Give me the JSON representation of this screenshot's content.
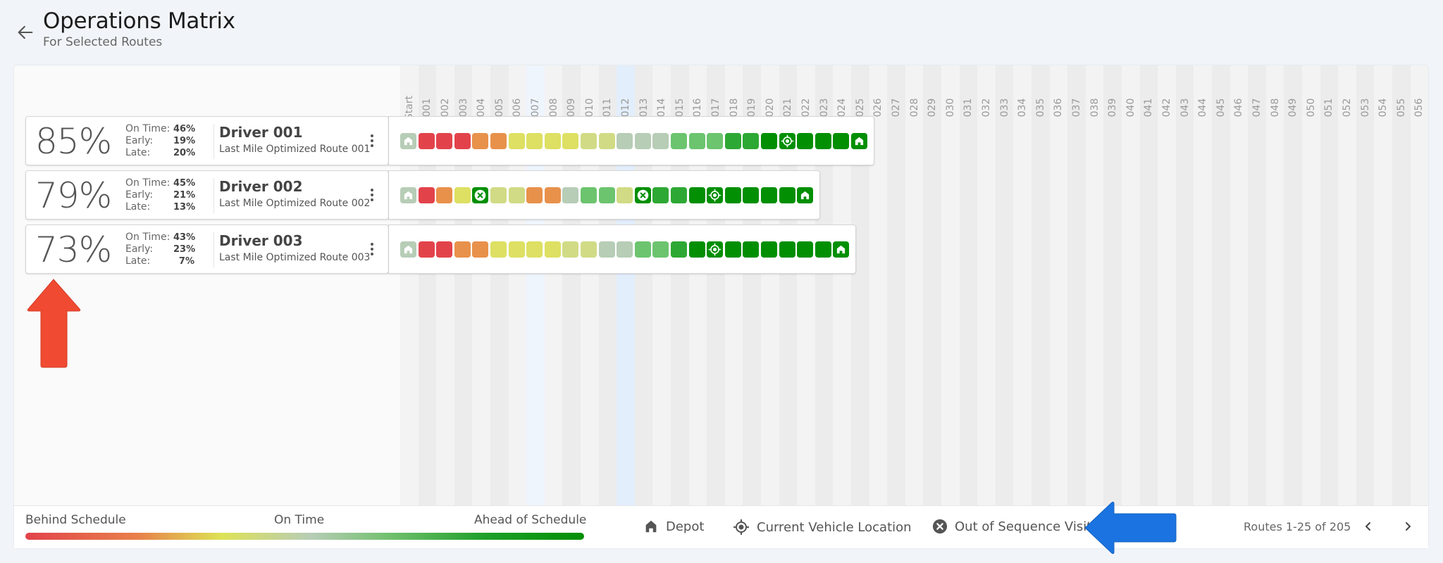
{
  "header": {
    "title": "Operations Matrix",
    "subtitle": "For Selected Routes",
    "back_icon": "arrow-left-icon"
  },
  "columns": [
    "Start",
    "001",
    "002",
    "003",
    "004",
    "005",
    "006",
    "007",
    "008",
    "009",
    "010",
    "011",
    "012",
    "013",
    "014",
    "015",
    "016",
    "017",
    "018",
    "019",
    "020",
    "021",
    "022",
    "023",
    "024",
    "025",
    "026",
    "027",
    "028",
    "029",
    "030",
    "031",
    "032",
    "033",
    "034",
    "035",
    "036",
    "037",
    "038",
    "039",
    "040",
    "041",
    "042",
    "043",
    "044",
    "045",
    "046",
    "047",
    "048",
    "049",
    "050",
    "051",
    "052",
    "053",
    "054",
    "055",
    "056"
  ],
  "highlighted_columns": {
    "faint": "007",
    "selected": "012"
  },
  "status_colors": {
    "red": "#e2434b",
    "orange": "#e8914b",
    "yellow": "#dde062",
    "pale": "#d1db85",
    "grey": "#b7cdb6",
    "light_green": "#6cc46f",
    "medium_green": "#2ea834",
    "dark_green": "#028f04",
    "depot_start": "#b7cdb6"
  },
  "routes": [
    {
      "score": "85%",
      "on_time_label": "On Time:",
      "on_time": "46%",
      "early_label": "Early:",
      "early": "19%",
      "late_label": "Late:",
      "late": "20%",
      "driver": "Driver 001",
      "route_name": "Last Mile Optimized Route 001",
      "stops": [
        "depot-start",
        "red",
        "red",
        "red",
        "orange",
        "orange",
        "yellow",
        "yellow",
        "yellow",
        "yellow",
        "pale",
        "pale",
        "grey",
        "grey",
        "grey",
        "light_green",
        "light_green",
        "light_green",
        "medium_green",
        "medium_green",
        "dark_green",
        "location",
        "dark_green",
        "dark_green",
        "dark_green",
        "depot-end"
      ]
    },
    {
      "score": "79%",
      "on_time_label": "On Time:",
      "on_time": "45%",
      "early_label": "Early:",
      "early": "21%",
      "late_label": "Late:",
      "late": "13%",
      "driver": "Driver 002",
      "route_name": "Last Mile Optimized Route 002",
      "stops": [
        "depot-start",
        "red",
        "orange",
        "yellow",
        "out-of-sequence",
        "pale",
        "pale",
        "orange",
        "orange",
        "grey",
        "light_green",
        "light_green",
        "pale",
        "out-of-sequence",
        "medium_green",
        "medium_green",
        "dark_green",
        "location",
        "dark_green",
        "dark_green",
        "dark_green",
        "dark_green",
        "depot-end"
      ]
    },
    {
      "score": "73%",
      "on_time_label": "On Time:",
      "on_time": "43%",
      "early_label": "Early:",
      "early": "23%",
      "late_label": "Late:",
      "late": "7%",
      "driver": "Driver 003",
      "route_name": "Last Mile Optimized Route 003",
      "stops": [
        "depot-start",
        "red",
        "red",
        "orange",
        "orange",
        "yellow",
        "yellow",
        "yellow",
        "yellow",
        "pale",
        "pale",
        "grey",
        "grey",
        "light_green",
        "light_green",
        "medium_green",
        "dark_green",
        "location",
        "dark_green",
        "dark_green",
        "dark_green",
        "dark_green",
        "dark_green",
        "dark_green",
        "depot-end"
      ]
    }
  ],
  "legend": {
    "behind": "Behind Schedule",
    "on_time": "On Time",
    "ahead": "Ahead of Schedule",
    "depot": "Depot",
    "current_location": "Current Vehicle Location",
    "out_of_sequence": "Out of Sequence Visit"
  },
  "pagination": {
    "text": "Routes 1-25 of 205",
    "prev_icon": "chevron-left-icon",
    "next_icon": "chevron-right-icon"
  },
  "annotations": {
    "up_arrow_color": "#f04a32",
    "left_arrow_color": "#1a73e0"
  }
}
